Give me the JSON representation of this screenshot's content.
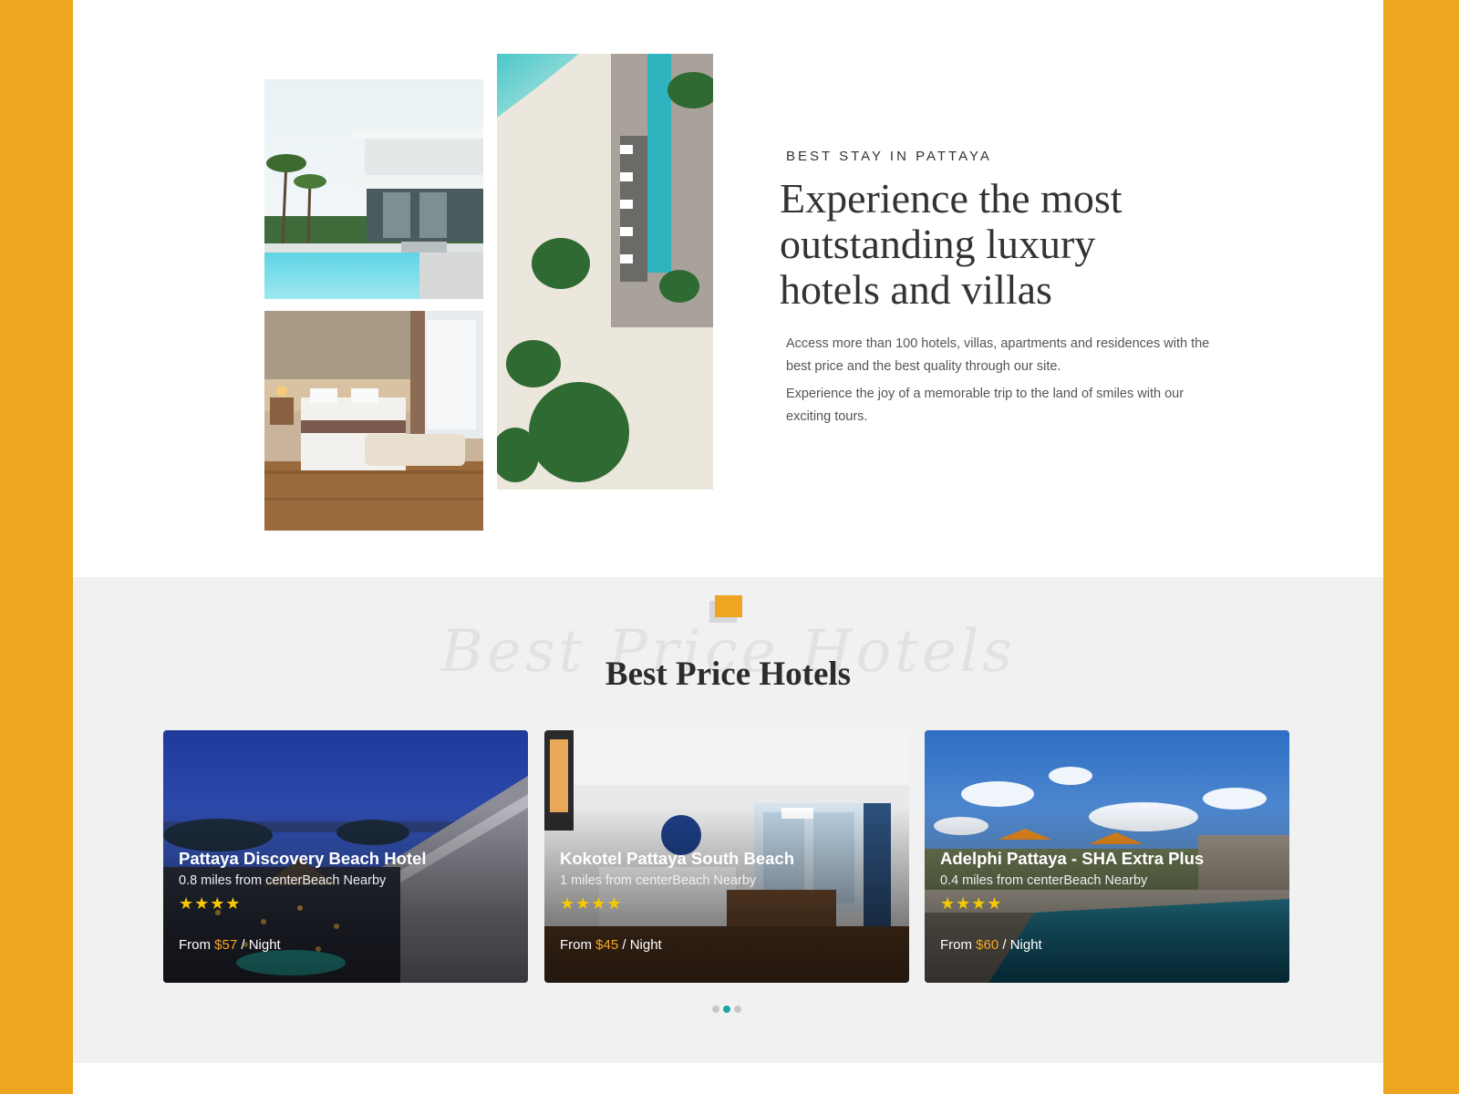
{
  "intro": {
    "eyebrow": "BEST STAY IN PATTAYA",
    "headline": "Experience the most outstanding luxury hotels and villas",
    "paragraph_1": "Access more than 100 hotels, villas, apartments and residences with the best price and the best quality through our site.",
    "paragraph_2": "Experience the joy of a memorable trip to the land of smiles with our exciting tours."
  },
  "hotels_section": {
    "title": "Best Price Hotels",
    "background_script": "Best Price Hotels",
    "accent_color": "#EEA520",
    "cards": [
      {
        "name": "Pattaya Discovery Beach Hotel",
        "distance": "0.8 miles from centerBeach Nearby",
        "stars": "★★★★",
        "from_label": "From",
        "price": "$57",
        "per_label": "/ Night"
      },
      {
        "name": "Kokotel Pattaya South Beach",
        "distance": "1 miles from centerBeach Nearby",
        "stars": "★★★★",
        "from_label": "From",
        "price": "$45",
        "per_label": "/ Night"
      },
      {
        "name": "Adelphi Pattaya - SHA Extra Plus",
        "distance": "0.4 miles from centerBeach Nearby",
        "stars": "★★★★",
        "from_label": "From",
        "price": "$60",
        "per_label": "/ Night"
      }
    ],
    "carousel": {
      "pages": 3,
      "active_index": 1
    }
  },
  "colors": {
    "page_background": "#EEA520",
    "price_highlight": "#F5A623",
    "star_color": "#F7C800",
    "active_dot": "#1aa6a6"
  }
}
